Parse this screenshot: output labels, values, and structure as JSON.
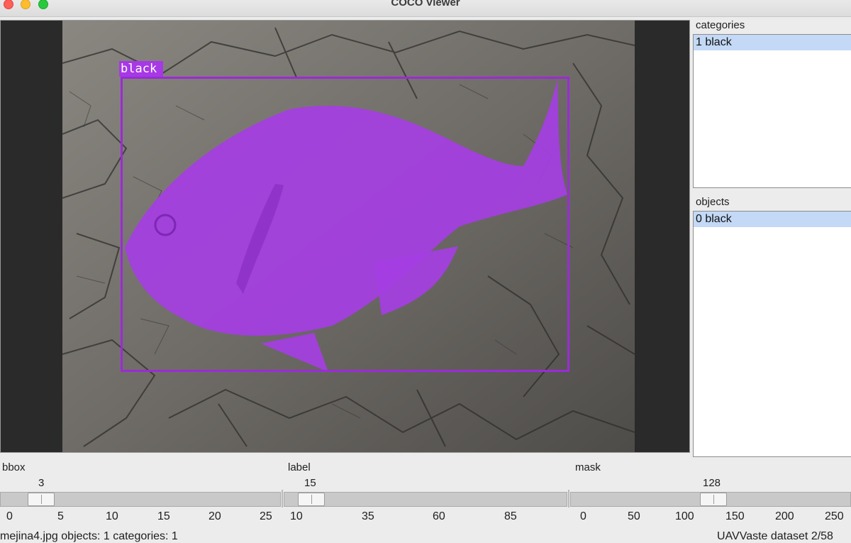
{
  "window": {
    "title": "COCO Viewer"
  },
  "viewer": {
    "annotation_label": "black",
    "overlay_color": "#a738e6",
    "bbox_color": "#9b2bd6"
  },
  "categories": {
    "label": "categories",
    "items": [
      "1 black"
    ],
    "selected": "1 black"
  },
  "objects": {
    "label": "objects",
    "items": [
      "0 black"
    ],
    "selected": "0 black"
  },
  "sliders": {
    "bbox": {
      "label": "bbox",
      "value": "3",
      "ticks": [
        "0",
        "5",
        "10",
        "15",
        "20",
        "25"
      ]
    },
    "label": {
      "label": "label",
      "value": "15",
      "ticks": [
        "10",
        "35",
        "60",
        "85"
      ]
    },
    "mask": {
      "label": "mask",
      "value": "128",
      "ticks": [
        "0",
        "50",
        "100",
        "150",
        "200",
        "250"
      ]
    }
  },
  "status": {
    "left": "mejina4.jpg   objects: 1   categories: 1",
    "right": "UAVVaste dataset   2/58"
  }
}
